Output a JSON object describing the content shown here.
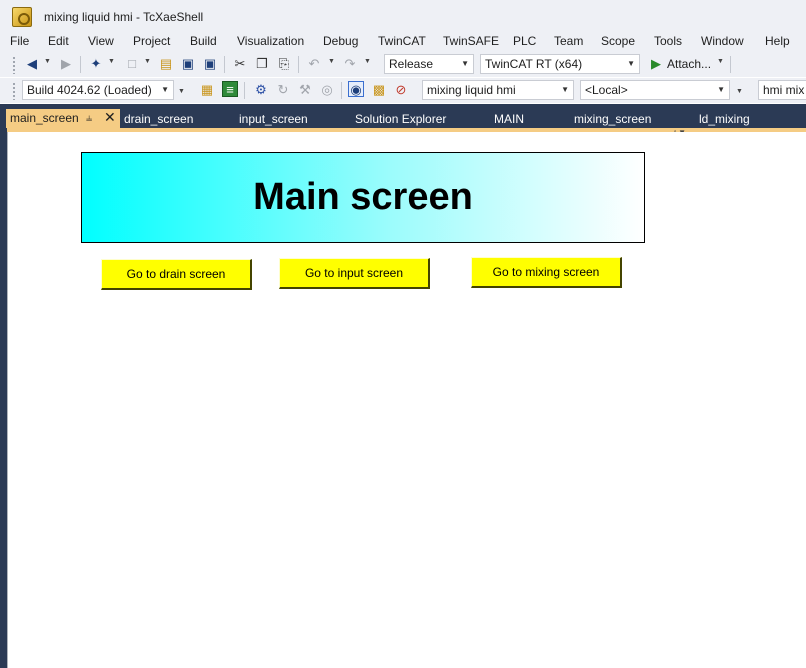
{
  "window": {
    "title": "mixing liquid hmi - TcXaeShell"
  },
  "menu": [
    "File",
    "Edit",
    "View",
    "Project",
    "Build",
    "Visualization",
    "Debug",
    "TwinCAT",
    "TwinSAFE",
    "PLC",
    "Team",
    "Scope",
    "Tools",
    "Window",
    "Help"
  ],
  "toolbar1": {
    "configuration": "Release",
    "platform": "TwinCAT RT (x64)",
    "attach_label": "Attach..."
  },
  "toolbar2": {
    "build": "Build 4024.62 (Loaded)",
    "project": "mixing liquid hmi",
    "target": "<Local>",
    "plc_project": "hmi mix"
  },
  "tabs": [
    "main_screen",
    "drain_screen",
    "input_screen",
    "Solution Explorer",
    "MAIN",
    "mixing_screen",
    "ld_mixing"
  ],
  "icons": {
    "pin": "pin-icon",
    "close": "close-icon"
  },
  "visualization": {
    "title": "Main screen",
    "buttons": {
      "drain": "Go to drain screen",
      "input": "Go to input screen",
      "mixing": "Go to mixing screen"
    },
    "colors": {
      "banner_start": "#00ffff",
      "button_fill": "#ffff00"
    }
  }
}
